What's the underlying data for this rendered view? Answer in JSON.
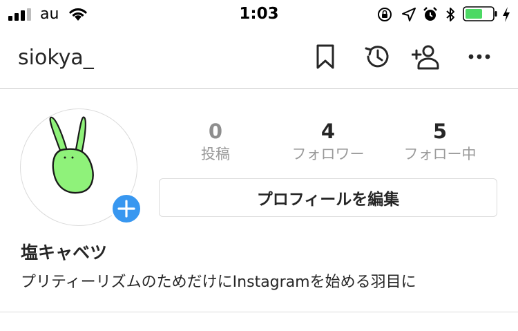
{
  "status_bar": {
    "carrier": "au",
    "time": "1:03",
    "battery_color": "#4cd964"
  },
  "nav": {
    "username": "siokya_",
    "icons": [
      "bookmark-icon",
      "history-icon",
      "add-person-icon",
      "more-icon"
    ]
  },
  "profile": {
    "avatar": "green-rabbit-drawing",
    "add_story_icon": "plus-icon",
    "accent_color": "#3897f0",
    "stats": [
      {
        "value": "0",
        "label": "投稿"
      },
      {
        "value": "4",
        "label": "フォロワー"
      },
      {
        "value": "5",
        "label": "フォロー中"
      }
    ],
    "edit_button_label": "プロフィールを編集",
    "display_name": "塩キャベツ",
    "bio": "プリティーリズムのためだけにInstagramを始める羽目に"
  }
}
